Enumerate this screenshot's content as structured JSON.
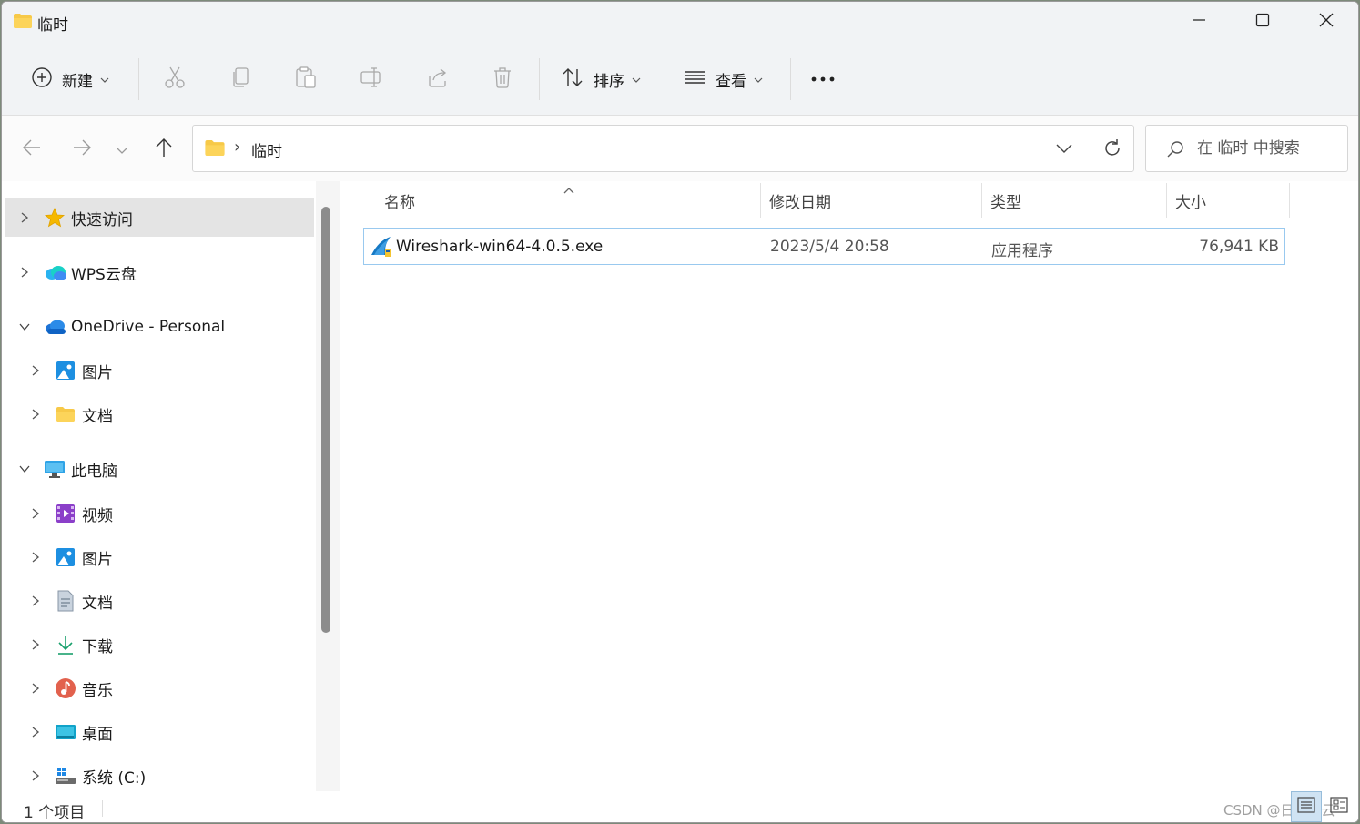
{
  "window": {
    "title": "临时",
    "minimize_icon": "minimize-icon",
    "maximize_icon": "maximize-icon",
    "close_icon": "close-icon"
  },
  "toolbar": {
    "new_label": "新建",
    "sort_label": "排序",
    "view_label": "查看",
    "icons": [
      "add-circle-icon",
      "cut-icon",
      "copy-icon",
      "paste-icon",
      "rename-icon",
      "share-icon",
      "delete-icon",
      "sort-icon",
      "view-lines-icon",
      "more-icon"
    ]
  },
  "nav": {
    "address_folder": "临时",
    "search_placeholder": "在 临时 中搜索"
  },
  "sidebar": {
    "items": [
      {
        "label": "快速访问",
        "icon": "star-icon",
        "expanded": false,
        "selected": true,
        "level": 0
      },
      {
        "label": "WPS云盘",
        "icon": "cloud-icon",
        "expanded": false,
        "selected": false,
        "level": 0
      },
      {
        "label": "OneDrive - Personal",
        "icon": "onedrive-icon",
        "expanded": true,
        "selected": false,
        "level": 0
      },
      {
        "label": "图片",
        "icon": "pictures-icon",
        "expanded": false,
        "selected": false,
        "level": 1
      },
      {
        "label": "文档",
        "icon": "folder-icon",
        "expanded": false,
        "selected": false,
        "level": 1
      },
      {
        "label": "此电脑",
        "icon": "monitor-icon",
        "expanded": true,
        "selected": false,
        "level": 0
      },
      {
        "label": "视频",
        "icon": "video-icon",
        "expanded": false,
        "selected": false,
        "level": 1
      },
      {
        "label": "图片",
        "icon": "pictures-icon",
        "expanded": false,
        "selected": false,
        "level": 1
      },
      {
        "label": "文档",
        "icon": "document-icon",
        "expanded": false,
        "selected": false,
        "level": 1
      },
      {
        "label": "下载",
        "icon": "download-icon",
        "expanded": false,
        "selected": false,
        "level": 1
      },
      {
        "label": "音乐",
        "icon": "music-icon",
        "expanded": false,
        "selected": false,
        "level": 1
      },
      {
        "label": "桌面",
        "icon": "desktop-icon",
        "expanded": false,
        "selected": false,
        "level": 1
      },
      {
        "label": "系统 (C:)",
        "icon": "drive-icon",
        "expanded": false,
        "selected": false,
        "level": 1
      }
    ]
  },
  "content": {
    "columns": [
      "名称",
      "修改日期",
      "类型",
      "大小"
    ],
    "files": [
      {
        "name": "Wireshark-win64-4.0.5.exe",
        "modified": "2023/5/4 20:58",
        "type": "应用程序",
        "size": "76,941 KB",
        "icon": "wireshark-icon"
      }
    ]
  },
  "status": {
    "item_count": "1 个项目",
    "watermark": "CSDN @日星月云"
  },
  "colors": {
    "accent": "#0067c0",
    "selection_border": "#99c9ef",
    "sidebar_selected": "#e4e4e4",
    "toolbar_bg": "#f1f3f5"
  }
}
